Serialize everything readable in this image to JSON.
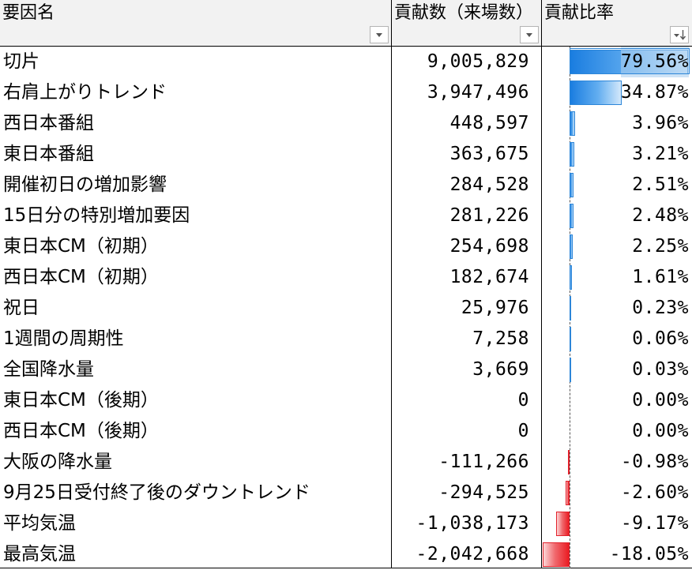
{
  "columns": [
    {
      "label": "要因名"
    },
    {
      "label": "貢献数（来場数）"
    },
    {
      "label": "貢献比率"
    }
  ],
  "rows": [
    {
      "name": "切片",
      "count": "9,005,829",
      "ratio": "79.56%",
      "ratio_value": 79.56
    },
    {
      "name": "右肩上がりトレンド",
      "count": "3,947,496",
      "ratio": "34.87%",
      "ratio_value": 34.87
    },
    {
      "name": "西日本番組",
      "count": "448,597",
      "ratio": "3.96%",
      "ratio_value": 3.96
    },
    {
      "name": "東日本番組",
      "count": "363,675",
      "ratio": "3.21%",
      "ratio_value": 3.21
    },
    {
      "name": "開催初日の増加影響",
      "count": "284,528",
      "ratio": "2.51%",
      "ratio_value": 2.51
    },
    {
      "name": "15日分の特別増加要因",
      "count": "281,226",
      "ratio": "2.48%",
      "ratio_value": 2.48
    },
    {
      "name": "東日本CM（初期）",
      "count": "254,698",
      "ratio": "2.25%",
      "ratio_value": 2.25
    },
    {
      "name": "西日本CM（初期）",
      "count": "182,674",
      "ratio": "1.61%",
      "ratio_value": 1.61
    },
    {
      "name": "祝日",
      "count": "25,976",
      "ratio": "0.23%",
      "ratio_value": 0.23
    },
    {
      "name": "1週間の周期性",
      "count": "7,258",
      "ratio": "0.06%",
      "ratio_value": 0.06
    },
    {
      "name": "全国降水量",
      "count": "3,669",
      "ratio": "0.03%",
      "ratio_value": 0.03
    },
    {
      "name": "東日本CM（後期）",
      "count": "0",
      "ratio": "0.00%",
      "ratio_value": 0.0
    },
    {
      "name": "西日本CM（後期）",
      "count": "0",
      "ratio": "0.00%",
      "ratio_value": 0.0
    },
    {
      "name": "大阪の降水量",
      "count": "-111,266",
      "ratio": "-0.98%",
      "ratio_value": -0.98
    },
    {
      "name": "9月25日受付終了後のダウントレンド",
      "count": "-294,525",
      "ratio": "-2.60%",
      "ratio_value": -2.6
    },
    {
      "name": "平均気温",
      "count": "-1,038,173",
      "ratio": "-9.17%",
      "ratio_value": -9.17
    },
    {
      "name": "最高気温",
      "count": "-2,042,668",
      "ratio": "-18.05%",
      "ratio_value": -18.05
    }
  ],
  "data_bar": {
    "positive_color": "#1a7de0",
    "negative_color": "#ea1c23",
    "max_value": 79.56,
    "min_value": -18.05
  },
  "icons": {
    "filter": "dropdown-arrow-icon",
    "sorted_filter": "sort-descending-filter-icon"
  }
}
